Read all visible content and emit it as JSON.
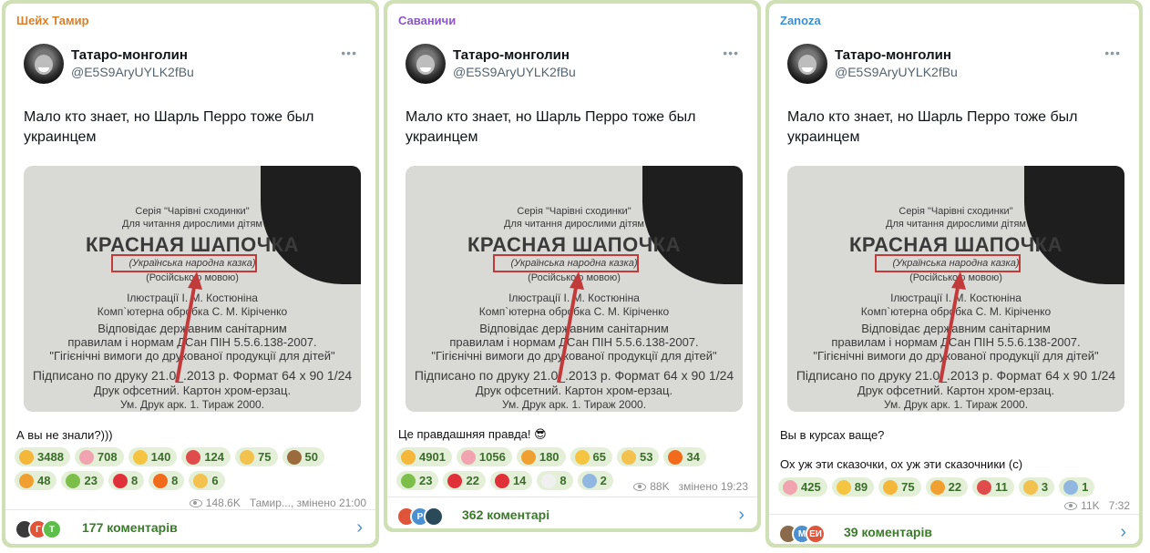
{
  "posts": [
    {
      "channel": "Шейх Тамир",
      "channel_color": "#d9802a",
      "tweet_name": "Татаро-монголин",
      "tweet_handle": "@E5S9AryUYLK2fBu",
      "tweet_more": "•••",
      "tweet_text": "Мало кто знает, но Шарль Перро тоже был украинцем",
      "photo_lines": [
        "Серія \"Чарівні сходинки\"",
        "Для читання дирослими дітям",
        "КРАСНАЯ ШАПОЧКА",
        "(Українська народна казка)",
        "(Російською мовою)",
        "Ілюстрації І. М. Костюніна",
        "Комп`ютерна обробка С. М. Кіріченко",
        "Відповідає державним санітарним",
        "правилам і нормам ДСан ПІН 5.5.6.138-2007.",
        "\"Гігієнічні вимоги до друкованої продукції для дітей\"",
        "Підписано по друку 21.0_.2013 р. Формат 64 х 90 1/24",
        "Друк офсетний. Картон хром-ерзац.",
        "Ум. Друк арк. 1. Тираж 2000."
      ],
      "caption": "А вы не знали?)))",
      "caption2": "",
      "reactions": [
        {
          "icon": "rofl-emoji",
          "count": "3488",
          "color": "#f5b73a"
        },
        {
          "icon": "pig-emoji",
          "count": "708",
          "color": "#f2a3b0"
        },
        {
          "icon": "grin-emoji",
          "count": "140",
          "color": "#f5c542"
        },
        {
          "icon": "pill-emoji",
          "count": "124",
          "color": "#e04b4b"
        },
        {
          "icon": "thumbs-up-emoji",
          "count": "75",
          "color": "#f2c14e"
        },
        {
          "icon": "see-no-evil-emoji",
          "count": "50",
          "color": "#9b6b3e"
        },
        {
          "icon": "exploding-head-emoji",
          "count": "48",
          "color": "#f0a030"
        },
        {
          "icon": "vomit-emoji",
          "count": "23",
          "color": "#7bbf4a"
        },
        {
          "icon": "heart-emoji",
          "count": "8",
          "color": "#e0303a"
        },
        {
          "icon": "fire-emoji",
          "count": "8",
          "color": "#f26b1d"
        },
        {
          "icon": "thumbs-down-emoji",
          "count": "6",
          "color": "#f2c14e"
        }
      ],
      "views": "148.6K",
      "meta_text": "Тамир..., змінено 21:00",
      "comment_avatars": [
        {
          "t": "",
          "c": "#3a3a3a"
        },
        {
          "t": "Г",
          "c": "#e0543a"
        },
        {
          "t": "Т",
          "c": "#5bbf4a"
        }
      ],
      "comments": "177 коментарів"
    },
    {
      "channel": "Саваничи",
      "channel_color": "#8a56c9",
      "tweet_name": "Татаро-монголин",
      "tweet_handle": "@E5S9AryUYLK2fBu",
      "tweet_more": "•••",
      "tweet_text": "Мало кто знает, но Шарль Перро тоже был украинцем",
      "photo_lines": [
        "Серія \"Чарівні сходинки\"",
        "Для читання дирослими дітям",
        "КРАСНАЯ ШАПОЧКА",
        "(Українська народна казка)",
        "(Російською мовою)",
        "Ілюстрації І. М. Костюніна",
        "Комп`ютерна обробка С. М. Кіріченко",
        "Відповідає державним санітарним",
        "правилам і нормам ДСан ПІН 5.5.6.138-2007.",
        "\"Гігієнічні вимоги до друкованої продукції для дітей\"",
        "Підписано по друку 21.0_.2013 р. Формат 64 х 90 1/24",
        "Друк офсетний. Картон хром-ерзац.",
        "Ум. Друк арк. 1. Тираж 2000."
      ],
      "caption": "Це правдашняя правда! 😎",
      "caption2": "",
      "reactions": [
        {
          "icon": "rofl-emoji",
          "count": "4901",
          "color": "#f5b73a"
        },
        {
          "icon": "pig-emoji",
          "count": "1056",
          "color": "#f2a3b0"
        },
        {
          "icon": "exploding-head-emoji",
          "count": "180",
          "color": "#f0a030"
        },
        {
          "icon": "grin-emoji",
          "count": "65",
          "color": "#f5c542"
        },
        {
          "icon": "thumbs-up-emoji",
          "count": "53",
          "color": "#f2c14e"
        },
        {
          "icon": "fire-emoji",
          "count": "34",
          "color": "#f26b1d"
        },
        {
          "icon": "vomit-emoji",
          "count": "23",
          "color": "#7bbf4a"
        },
        {
          "icon": "hundred-emoji",
          "count": "22",
          "color": "#e0303a"
        },
        {
          "icon": "heart-emoji",
          "count": "14",
          "color": "#e0303a"
        },
        {
          "icon": "eyes-emoji",
          "count": "8",
          "color": "#f0f0f0"
        },
        {
          "icon": "scream-emoji",
          "count": "2",
          "color": "#8fb7e0"
        }
      ],
      "views": "88K",
      "meta_text": "змінено 19:23",
      "comment_avatars": [
        {
          "t": "",
          "c": "#e0543a"
        },
        {
          "t": "P",
          "c": "#4a8fcf"
        },
        {
          "t": "",
          "c": "#2a4a5a"
        }
      ],
      "comments": "362 коментарі"
    },
    {
      "channel": "Zanoza",
      "channel_color": "#3a8fd1",
      "tweet_name": "Татаро-монголин",
      "tweet_handle": "@E5S9AryUYLK2fBu",
      "tweet_more": "•••",
      "tweet_text": "Мало кто знает, но Шарль Перро тоже был украинцем",
      "photo_lines": [
        "Серія \"Чарівні сходинки\"",
        "Для читання дирослими дітям",
        "КРАСНАЯ ШАПОЧКА",
        "(Українська народна казка)",
        "(Російською мовою)",
        "Ілюстрації І. М. Костюніна",
        "Комп`ютерна обробка С. М. Кіріченко",
        "Відповідає державним санітарним",
        "правилам і нормам ДСан ПІН 5.5.6.138-2007.",
        "\"Гігієнічні вимоги до друкованої продукції для дітей\"",
        "Підписано по друку 21.0_.2013 р. Формат 64 х 90 1/24",
        "Друк офсетний. Картон хром-ерзац.",
        "Ум. Друк арк. 1. Тираж 2000."
      ],
      "caption": "Вы в курсах ваще?",
      "caption2": "Ох уж эти сказочки, ох уж эти сказочники (с)",
      "reactions": [
        {
          "icon": "pig-emoji",
          "count": "425",
          "color": "#f2a3b0"
        },
        {
          "icon": "grin-emoji",
          "count": "89",
          "color": "#f5c542"
        },
        {
          "icon": "rofl-emoji",
          "count": "75",
          "color": "#f5b73a"
        },
        {
          "icon": "exploding-head-emoji",
          "count": "22",
          "color": "#f0a030"
        },
        {
          "icon": "pill-emoji",
          "count": "11",
          "color": "#e04b4b"
        },
        {
          "icon": "thumbs-up-emoji",
          "count": "3",
          "color": "#f2c14e"
        },
        {
          "icon": "scream-emoji",
          "count": "1",
          "color": "#8fb7e0"
        }
      ],
      "views": "11K",
      "meta_text": "7:32",
      "comment_avatars": [
        {
          "t": "",
          "c": "#8a6a4a"
        },
        {
          "t": "M",
          "c": "#4a8fcf"
        },
        {
          "t": "ЕИ",
          "c": "#e0543a"
        }
      ],
      "comments": "39 коментарів"
    }
  ]
}
